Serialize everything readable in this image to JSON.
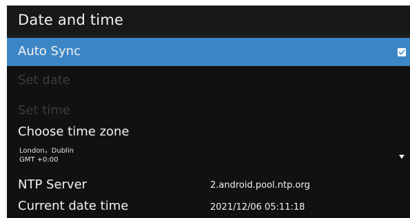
{
  "header": {
    "title": "Date and time"
  },
  "settings": {
    "auto_sync": {
      "label": "Auto Sync",
      "checked": true,
      "selected": true
    },
    "set_date": {
      "label": "Set date",
      "enabled": false
    },
    "set_time": {
      "label": "Set time",
      "enabled": false
    },
    "time_zone": {
      "label": "Choose time zone",
      "city": "London，Dublin",
      "offset": "GMT +0:00"
    },
    "ntp_server": {
      "label": "NTP Server",
      "value": "2.android.pool.ntp.org"
    },
    "current_datetime": {
      "label": "Current date time",
      "value": "2021/12/06 05:11:18"
    }
  },
  "icons": {
    "checkbox": "checkbox-checked-icon",
    "dropdown": "dropdown-arrow-icon"
  },
  "colors": {
    "background": "#111111",
    "highlight": "#3d86c6",
    "text": "#f2f2f2",
    "disabled_text": "#3c3c3c"
  }
}
